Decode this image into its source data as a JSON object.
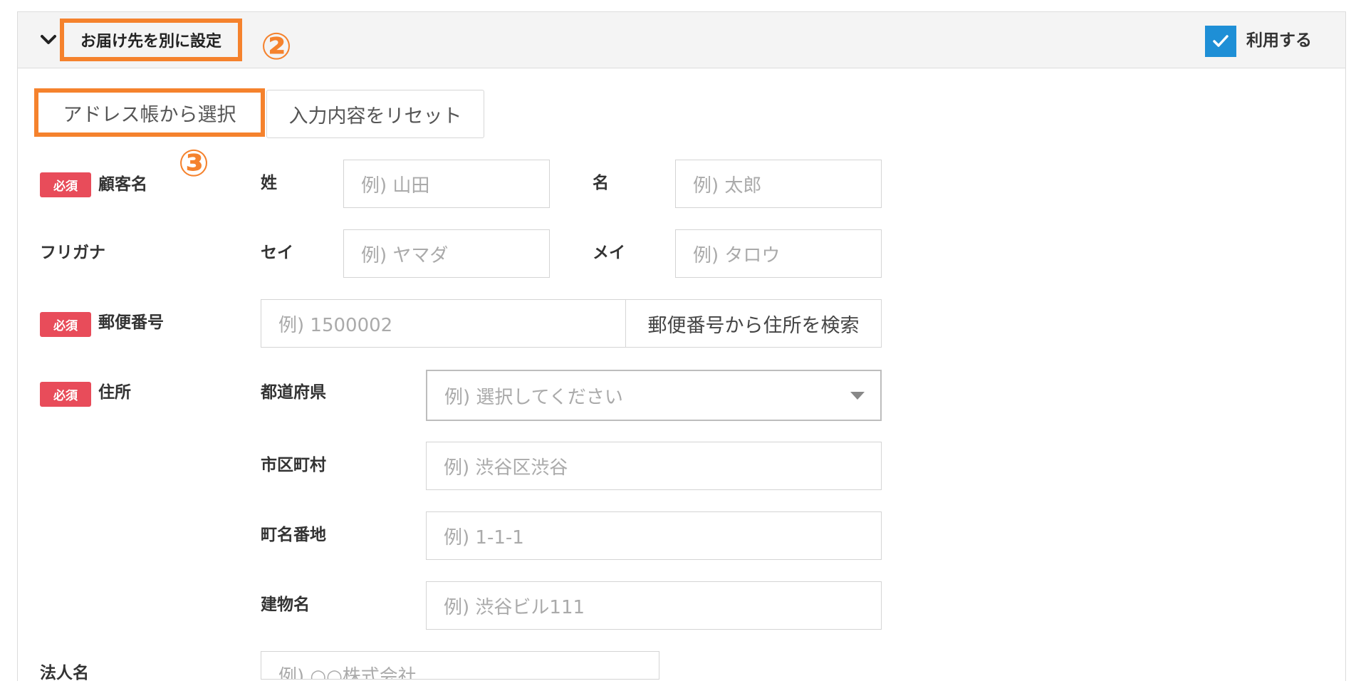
{
  "header": {
    "title": "お届け先を別に設定",
    "use_label": "利用する",
    "use_checked": true
  },
  "annotations": {
    "step2": "②",
    "step3": "③"
  },
  "buttons": {
    "address_book": "アドレス帳から選択",
    "reset": "入力内容をリセット",
    "zip_search": "郵便番号から住所を検索"
  },
  "required_badge": "必須",
  "name": {
    "label": "顧客名",
    "last_label": "姓",
    "last_placeholder": "例) 山田",
    "first_label": "名",
    "first_placeholder": "例) 太郎"
  },
  "kana": {
    "label": "フリガナ",
    "last_label": "セイ",
    "last_placeholder": "例) ヤマダ",
    "first_label": "メイ",
    "first_placeholder": "例) タロウ"
  },
  "zip": {
    "label": "郵便番号",
    "placeholder": "例) 1500002"
  },
  "address": {
    "label": "住所",
    "prefecture_label": "都道府県",
    "prefecture_placeholder": "例) 選択してください",
    "city_label": "市区町村",
    "city_placeholder": "例) 渋谷区渋谷",
    "street_label": "町名番地",
    "street_placeholder": "例) 1-1-1",
    "building_label": "建物名",
    "building_placeholder": "例) 渋谷ビル111"
  },
  "company": {
    "label": "法人名",
    "placeholder": "例) ○○株式会社"
  },
  "colors": {
    "accent_orange": "#f5822d",
    "checkbox_blue": "#1e8fd6",
    "required_red": "#e84c5a"
  }
}
